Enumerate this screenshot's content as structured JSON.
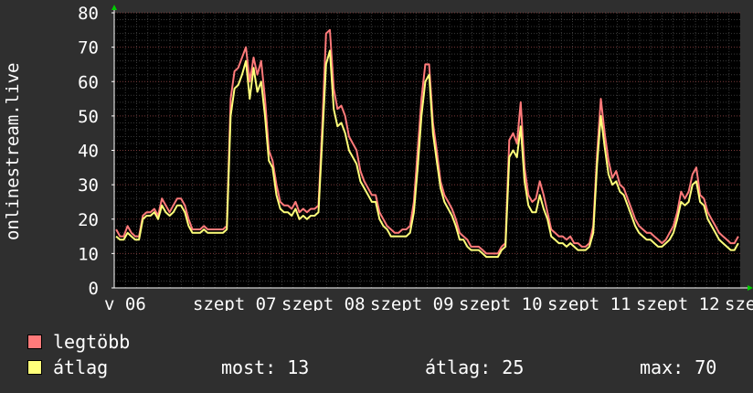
{
  "chart_data": {
    "type": "line",
    "ylabel": "onlinestream.live",
    "ylim": [
      0,
      80
    ],
    "yticks": [
      0,
      10,
      20,
      30,
      40,
      50,
      60,
      70,
      80
    ],
    "xlabels": [
      "v 06",
      "szept 07",
      "szept 08",
      "szept 09",
      "szept 10",
      "szept 11",
      "szept 12",
      "szept"
    ],
    "grid": true,
    "legend_position": "bottom-left",
    "series": [
      {
        "name": "legtöbb",
        "color": "#ff7a7a",
        "values": [
          17,
          15,
          15,
          18,
          16,
          15,
          15,
          21,
          22,
          22,
          23,
          21,
          26,
          24,
          22,
          24,
          26,
          26,
          24,
          20,
          17,
          17,
          17,
          18,
          17,
          17,
          17,
          17,
          17,
          18,
          55,
          63,
          64,
          67,
          70,
          60,
          67,
          62,
          66,
          55,
          40,
          37,
          30,
          25,
          24,
          24,
          23,
          25,
          22,
          23,
          22,
          23,
          23,
          24,
          47,
          74,
          75,
          58,
          52,
          53,
          50,
          44,
          42,
          40,
          34,
          31,
          29,
          27,
          27,
          22,
          20,
          18,
          17,
          16,
          16,
          17,
          17,
          18,
          25,
          40,
          55,
          65,
          65,
          48,
          40,
          31,
          27,
          25,
          23,
          20,
          16,
          15,
          14,
          12,
          12,
          12,
          11,
          10,
          10,
          10,
          10,
          12,
          13,
          43,
          45,
          42,
          54,
          35,
          27,
          25,
          26,
          31,
          27,
          22,
          17,
          16,
          15,
          15,
          14,
          15,
          13,
          13,
          12,
          12,
          13,
          18,
          39,
          55,
          45,
          37,
          32,
          34,
          30,
          29,
          26,
          23,
          20,
          18,
          17,
          16,
          16,
          15,
          14,
          13,
          14,
          16,
          18,
          22,
          28,
          26,
          28,
          33,
          35,
          27,
          26,
          22,
          20,
          18,
          16,
          15,
          14,
          13,
          13,
          15
        ]
      },
      {
        "name": "átlag",
        "color": "#ffff7a",
        "values": [
          15,
          14,
          14,
          16,
          15,
          14,
          14,
          20,
          21,
          21,
          22,
          20,
          24,
          22,
          21,
          22,
          24,
          24,
          22,
          18,
          16,
          16,
          16,
          17,
          16,
          16,
          16,
          16,
          16,
          17,
          50,
          58,
          59,
          62,
          66,
          55,
          64,
          57,
          60,
          50,
          37,
          35,
          27,
          23,
          22,
          22,
          21,
          23,
          20,
          21,
          20,
          21,
          21,
          22,
          43,
          65,
          69,
          52,
          47,
          48,
          45,
          40,
          38,
          36,
          31,
          29,
          27,
          25,
          25,
          20,
          18,
          17,
          15,
          15,
          15,
          15,
          15,
          16,
          22,
          35,
          50,
          60,
          62,
          45,
          37,
          29,
          25,
          23,
          21,
          18,
          14,
          14,
          12,
          11,
          11,
          11,
          10,
          9,
          9,
          9,
          9,
          11,
          12,
          38,
          40,
          38,
          47,
          31,
          24,
          22,
          22,
          27,
          23,
          20,
          15,
          14,
          13,
          13,
          12,
          13,
          12,
          11,
          11,
          11,
          12,
          16,
          36,
          50,
          41,
          33,
          30,
          31,
          28,
          27,
          24,
          21,
          18,
          16,
          15,
          14,
          14,
          13,
          12,
          12,
          13,
          14,
          16,
          20,
          25,
          24,
          25,
          30,
          31,
          25,
          24,
          20,
          18,
          16,
          14,
          13,
          12,
          11,
          11,
          13
        ]
      }
    ]
  },
  "legend": {
    "items": [
      {
        "label": "legtöbb",
        "color": "#ff7a7a"
      },
      {
        "label": "átlag",
        "color": "#ffff7a"
      }
    ],
    "stats": {
      "current_label": "most: 13",
      "average_label": "átlag: 25",
      "max_label": "max: 70"
    }
  }
}
